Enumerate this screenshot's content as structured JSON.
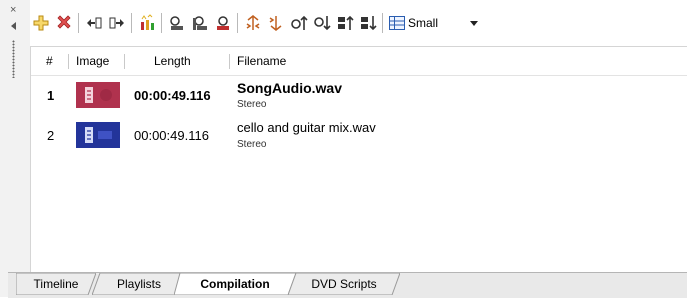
{
  "toolbar": {
    "items": [
      {
        "name": "add-icon"
      },
      {
        "name": "remove-icon"
      },
      {
        "name": "move-left-icon"
      },
      {
        "name": "move-right-icon"
      },
      {
        "name": "effects-icon"
      },
      {
        "name": "props-icon-1"
      },
      {
        "name": "props-icon-2"
      },
      {
        "name": "props-icon-3"
      },
      {
        "name": "fade-in-icon"
      },
      {
        "name": "fade-out-icon"
      },
      {
        "name": "move-up-icon"
      },
      {
        "name": "move-down-icon"
      },
      {
        "name": "sort-up-icon"
      },
      {
        "name": "sort-down-icon"
      }
    ],
    "size_select": {
      "label": "Small"
    }
  },
  "list": {
    "columns": {
      "num": "#",
      "image": "Image",
      "length": "Length",
      "filename": "Filename"
    },
    "rows": [
      {
        "num": "1",
        "length": "00:00:49.116",
        "filename": "SongAudio.wav",
        "type": "Stereo",
        "selected": true,
        "thumb_color": "#b0324e"
      },
      {
        "num": "2",
        "length": "00:00:49.116",
        "filename": "cello and guitar mix.wav",
        "type": "Stereo",
        "selected": false,
        "thumb_color": "#23349a"
      }
    ]
  },
  "tabs": [
    {
      "label": "Timeline",
      "active": false
    },
    {
      "label": "Playlists",
      "active": false
    },
    {
      "label": "Compilation",
      "active": true
    },
    {
      "label": "DVD Scripts",
      "active": false
    }
  ],
  "gutter": {
    "close_glyph": "×"
  }
}
